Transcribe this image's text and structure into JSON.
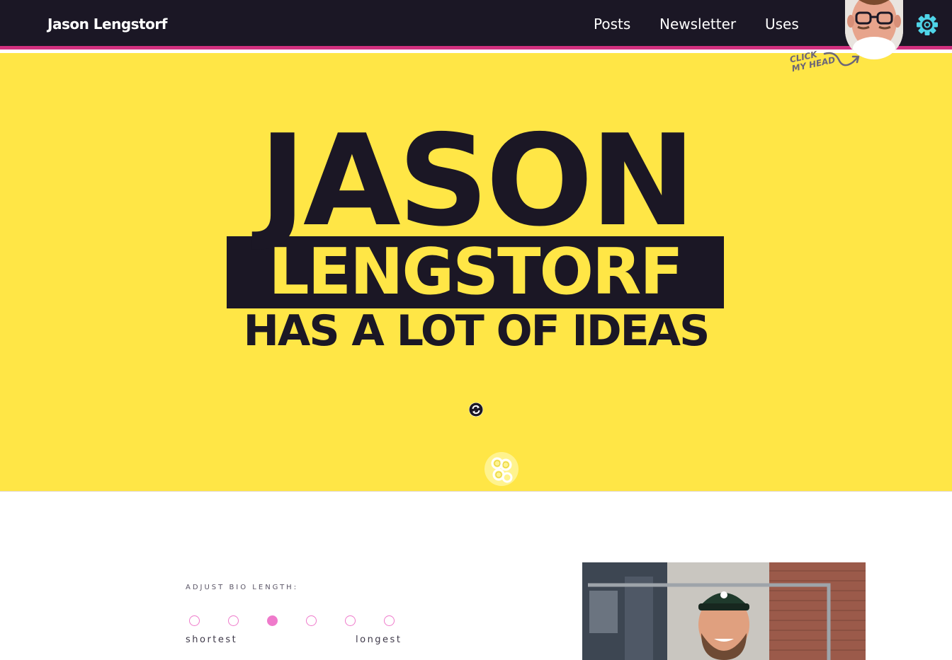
{
  "header": {
    "site_title": "Jason Lengstorf",
    "nav": [
      {
        "label": "Posts"
      },
      {
        "label": "Newsletter"
      },
      {
        "label": "Uses"
      }
    ],
    "head_note": "CLICK MY HEAD",
    "head_note_line1": "CLICK",
    "head_note_line2": "MY HEAD"
  },
  "hero": {
    "line1": "JASON",
    "line2": "LENGSTORF",
    "line3": "HAS A LOT OF IDEAS"
  },
  "bio": {
    "label": "ADJUST BIO LENGTH:",
    "selected_index": 2,
    "option_count": 6,
    "min_label": "shortest",
    "max_label": "longest"
  },
  "colors": {
    "header_bg": "#1b1725",
    "accent_border": "#d1307f",
    "hero_bg": "#ffe646",
    "dot_pink": "#ef7acb",
    "gear": "#4fd4e8"
  },
  "icons": {
    "settings": "gear-icon",
    "refresh": "refresh-icon"
  }
}
